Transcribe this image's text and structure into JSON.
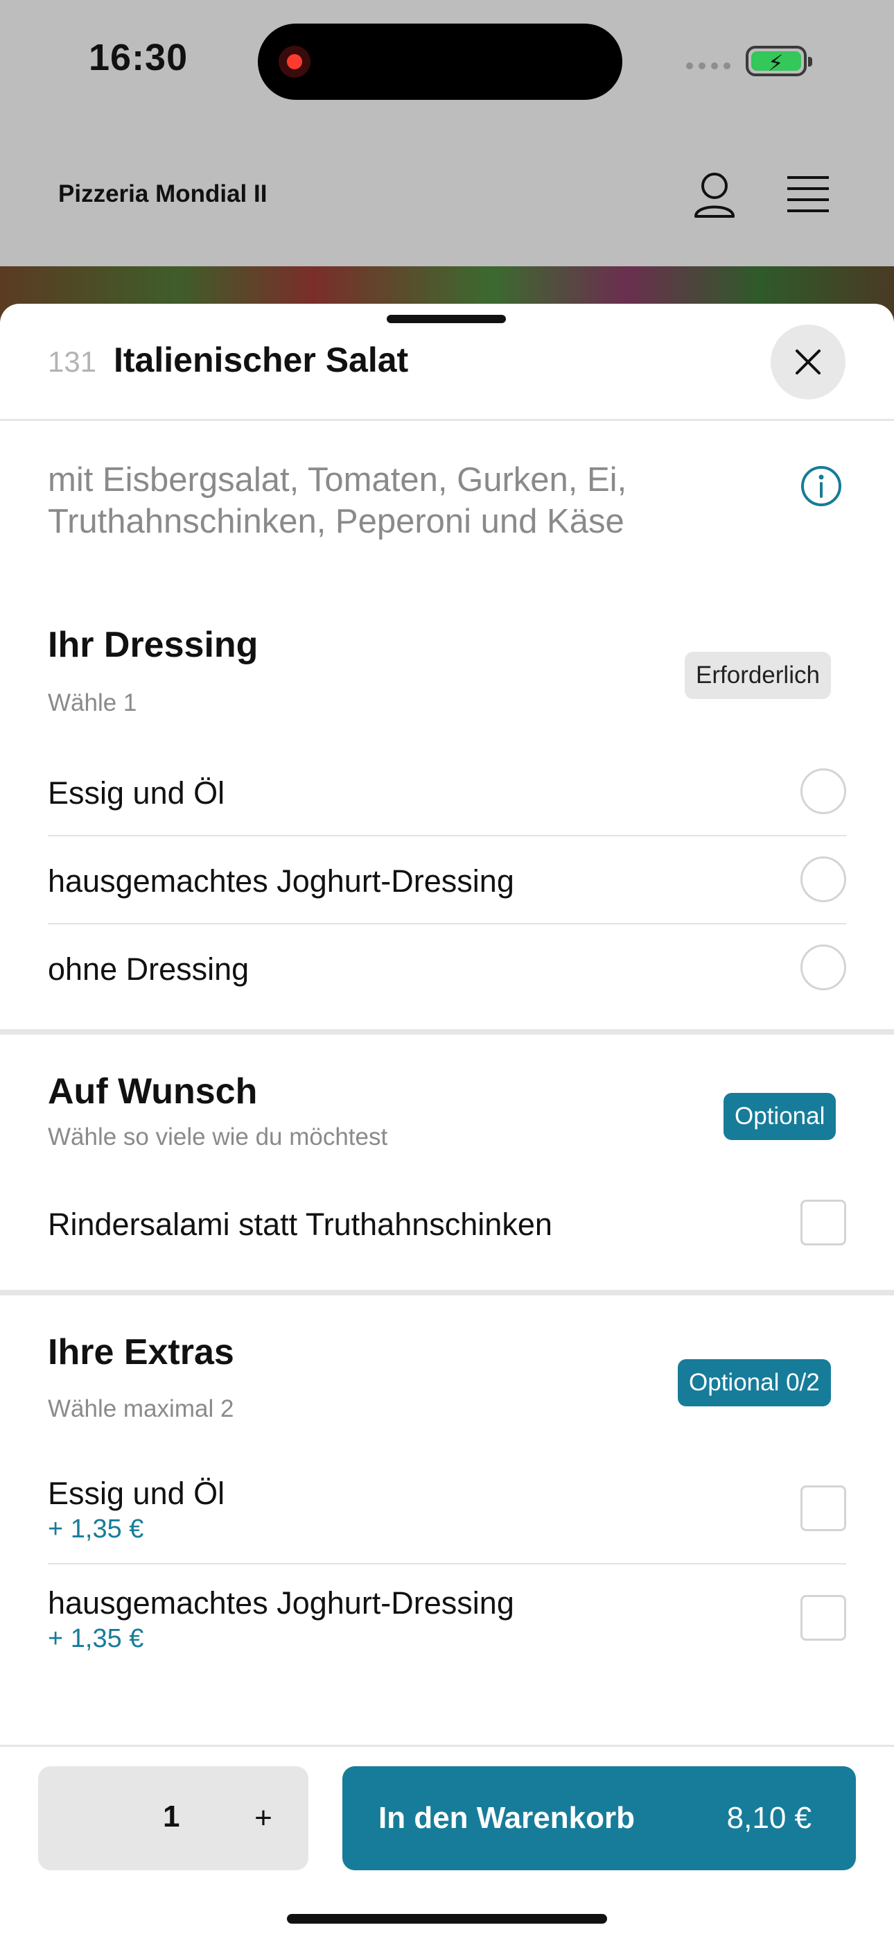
{
  "status": {
    "time": "16:30"
  },
  "header": {
    "brand": "Pizzeria Mondial II"
  },
  "item": {
    "number": "131",
    "title": "Italienischer Salat",
    "description": "mit Eisbergsalat, Tomaten, Gurken, Ei, Truthahnschinken, Peperoni und Käse"
  },
  "dressing": {
    "title": "Ihr Dressing",
    "subtitle": "Wähle 1",
    "badge": "Erforderlich",
    "options": [
      "Essig und Öl",
      "hausgemachtes Joghurt-Dressing",
      "ohne Dressing"
    ]
  },
  "wish": {
    "title": "Auf Wunsch",
    "subtitle": "Wähle so viele wie du möchtest",
    "badge": "Optional",
    "options": [
      "Rindersalami statt Truthahnschinken"
    ]
  },
  "extras": {
    "title": "Ihre Extras",
    "subtitle": "Wähle maximal 2",
    "badge": "Optional 0/2",
    "options": [
      {
        "label": "Essig und Öl",
        "price": "+ 1,35 €"
      },
      {
        "label": "hausgemachtes Joghurt-Dressing",
        "price": "+ 1,35 €"
      }
    ]
  },
  "footer": {
    "quantity": "1",
    "plus": "+",
    "cart_label": "In den Warenkorb",
    "cart_price": "8,10 €"
  },
  "colors": {
    "accent": "#177c99",
    "dim_background": "#bdbdbd"
  }
}
